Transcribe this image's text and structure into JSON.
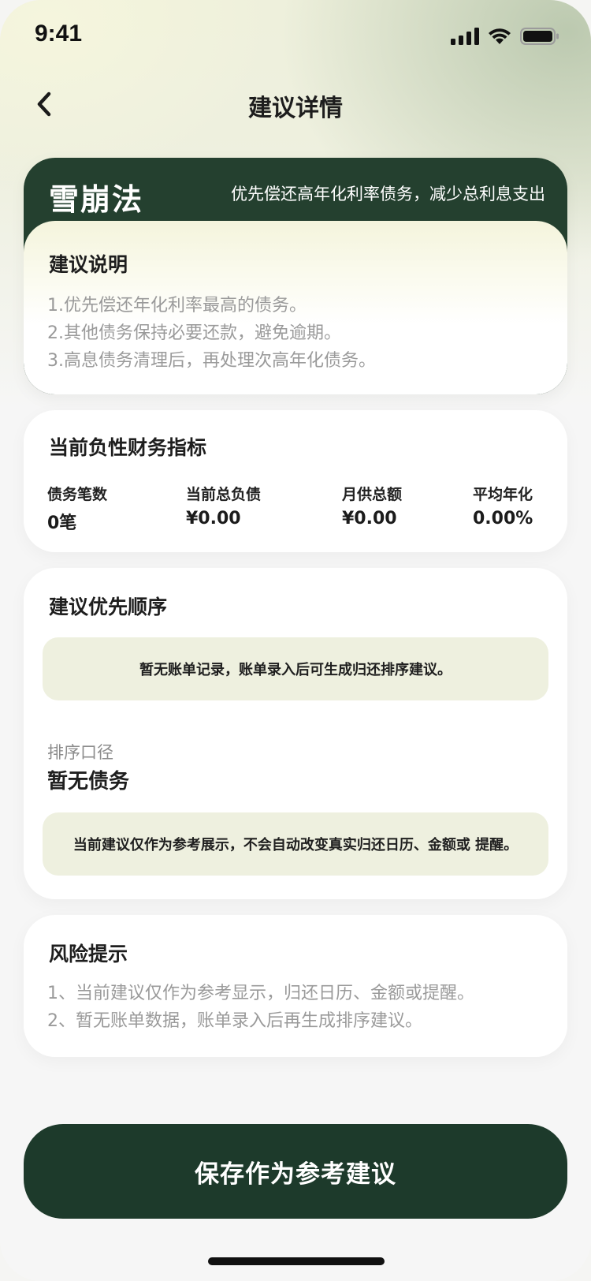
{
  "status_bar": {
    "time": "9:41",
    "icons": [
      "signal-icon",
      "wifi-icon",
      "battery-icon"
    ]
  },
  "nav": {
    "back_icon": "chevron-left-icon",
    "title": "建议详情"
  },
  "method": {
    "name": "雪崩法",
    "description": "优先偿还高年化利率债务，减少总利息支出",
    "explain_title": "建议说明",
    "explain_items": [
      "1.优先偿还年化利率最高的债务。",
      "2.其他债务保持必要还款，避免逾期。",
      "3.高息债务清理后，再处理次高年化债务。"
    ]
  },
  "metrics": {
    "title": "当前负性财务指标",
    "items": [
      {
        "label": "债务笔数",
        "value": "0笔"
      },
      {
        "label": "当前总负债",
        "value": "¥0.00"
      },
      {
        "label": "月供总额",
        "value": "¥0.00"
      },
      {
        "label": "平均年化",
        "value": "0.00%"
      }
    ]
  },
  "priority": {
    "title": "建议优先顺序",
    "empty_notice": "暂无账单记录，账单录入后可生成归还排序建议。",
    "sort_label": "排序口径",
    "sort_value": "暂无债务",
    "reference_notice": "当前建议仅作为参考展示，不会自动改变真实归还日历、金额或 提醒。"
  },
  "risk": {
    "title": "风险提示",
    "items": [
      "1、当前建议仅作为参考显示，归还日历、金额或提醒。",
      "2、暂无账单数据，账单录入后再生成排序建议。"
    ]
  },
  "actions": {
    "save_label": "保存作为参考建议"
  },
  "colors": {
    "primary_dark_green": "#1d3a2b",
    "header_green": "#24402f",
    "notice_bg": "#eef0df",
    "muted_text": "#9a9a9a"
  }
}
